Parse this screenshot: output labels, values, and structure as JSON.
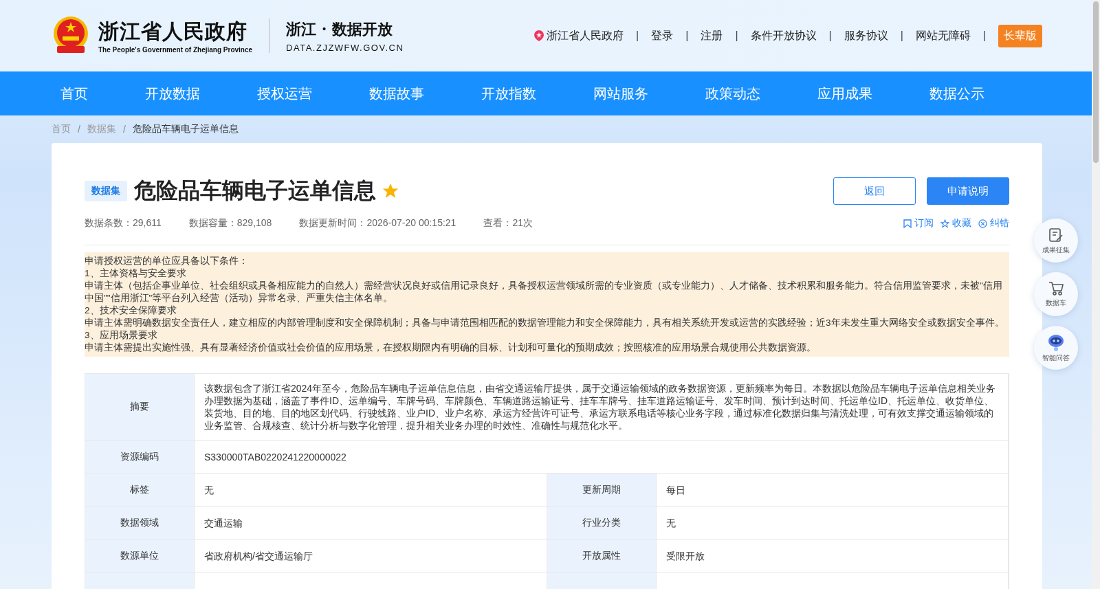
{
  "header": {
    "title_cn": "浙江省人民政府",
    "title_en": "The People's Government of Zhejiang Province",
    "portal_name": "浙江 · 数据开放",
    "portal_domain": "DATA.ZJZWFW.GOV.CN",
    "separator": "|",
    "links": [
      {
        "label": "浙江省人民政府",
        "kind": "location"
      },
      {
        "label": "登录",
        "kind": "link"
      },
      {
        "label": "注册",
        "kind": "link"
      },
      {
        "label": "条件开放协议",
        "kind": "link"
      },
      {
        "label": "服务协议",
        "kind": "link"
      },
      {
        "label": "网站无障碍",
        "kind": "link"
      },
      {
        "label": "长辈版",
        "kind": "button"
      }
    ]
  },
  "nav": [
    {
      "label": "首页",
      "selected": false
    },
    {
      "label": "开放数据",
      "selected": false
    },
    {
      "label": "授权运营",
      "selected": false
    },
    {
      "label": "数据故事",
      "selected": false
    },
    {
      "label": "开放指数",
      "selected": false
    },
    {
      "label": "网站服务",
      "selected": false
    },
    {
      "label": "政策动态",
      "selected": false
    },
    {
      "label": "应用成果",
      "selected": false
    },
    {
      "label": "数据公示",
      "selected": false
    }
  ],
  "breadcrumb": [
    "首页",
    "数据集",
    "危险品车辆电子运单信息"
  ],
  "breadcrumb_separator": "/",
  "dataset": {
    "badge": "数据集",
    "title": "危险品车辆电子运单信息",
    "favorited": true,
    "buttons": [
      {
        "label": "返回",
        "kind": "outline"
      },
      {
        "label": "申请说明",
        "kind": "primary"
      }
    ],
    "stats": [
      "数据条数：29,611",
      "数据容量：829,108",
      "数据更新时间：2026-07-20 00:15:21",
      "查看：21次"
    ],
    "actions": [
      {
        "label": "订阅",
        "kind": "subscribe"
      },
      {
        "label": "收藏",
        "kind": "favorite"
      },
      {
        "label": "纠错",
        "kind": "report"
      }
    ],
    "notice": [
      "申请授权运营的单位应具备以下条件：",
      "1、主体资格与安全要求",
      "申请主体（包括企事业单位、社会组织或具备相应能力的自然人）需经营状况良好或信用记录良好，具备授权运营领域所需的专业资质（或专业能力）、人才储备、技术积累和服务能力。符合信用监管要求，未被\"信用中国\"\"信用浙江\"等平台列入经营（活动）异常名录、严重失信主体名单。",
      "2、技术安全保障要求",
      "申请主体需明确数据安全责任人，建立相应的内部管理制度和安全保障机制；具备与申请范围相匹配的数据管理能力和安全保障能力，具有相关系统开发或运营的实践经验；近3年未发生重大网络安全或数据安全事件。",
      "3、应用场景要求",
      "申请主体需提出实施性强、具有显著经济价值或社会价值的应用场景，在授权期限内有明确的目标、计划和可量化的预期成效；按照核准的应用场景合规使用公共数据资源。"
    ],
    "table": [
      [
        {
          "label": "摘要",
          "value": "该数据包含了浙江省2024年至今，危险品车辆电子运单信息信息，由省交通运输厅提供，属于交通运输领域的政务数据资源，更新频率为每日。本数据以危险品车辆电子运单信息相关业务办理数据为基础，涵盖了事件ID、运单编号、车牌号码、车牌颜色、车辆道路运输证号、挂车车牌号、挂车道路运输证号、发车时间、预计到达时间、托运单位ID、托运单位、收货单位、装货地、目的地、目的地区划代码、行驶线路、业户ID、业户名称、承运方经营许可证号、承运方联系电话等核心业务字段，通过标准化数据归集与清洗处理，可有效支撑交通运输领域的业务监管、合规核查、统计分析与数字化管理，提升相关业务办理的时效性、准确性与规范化水平。"
        }
      ],
      [
        {
          "label": "资源编码",
          "value": "S330000TAB0220241220000022"
        }
      ],
      [
        {
          "label": "标签",
          "value": "无"
        },
        {
          "label": "更新周期",
          "value": "每日"
        }
      ],
      [
        {
          "label": "数据领域",
          "value": "交通运输"
        },
        {
          "label": "行业分类",
          "value": "无"
        }
      ],
      [
        {
          "label": "数源单位",
          "value": "省政府机构/省交通运输厅"
        },
        {
          "label": "开放属性",
          "value": "受限开放"
        }
      ]
    ]
  },
  "float_tools": [
    {
      "label": "成果征集",
      "kind": "edit"
    },
    {
      "label": "数据车",
      "kind": "cart"
    },
    {
      "label": "智能问答",
      "kind": "robot"
    }
  ]
}
